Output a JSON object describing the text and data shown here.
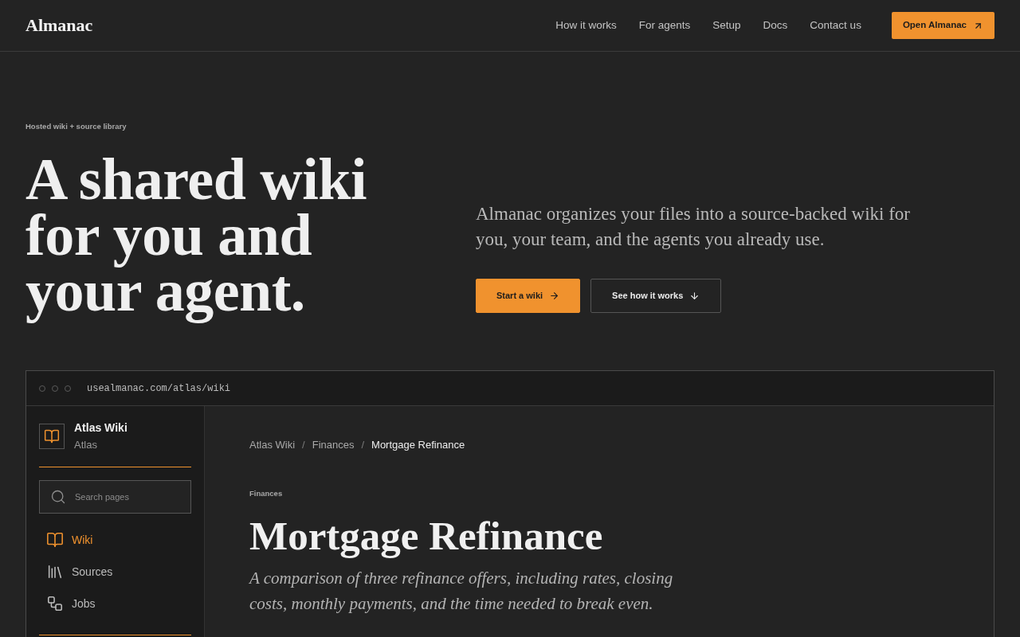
{
  "header": {
    "logo": "Almanac",
    "nav": [
      {
        "label": "How it works"
      },
      {
        "label": "For agents"
      },
      {
        "label": "Setup"
      },
      {
        "label": "Docs"
      },
      {
        "label": "Contact us"
      }
    ],
    "cta": "Open Almanac"
  },
  "hero": {
    "eyebrow": "Hosted wiki + source library",
    "headline": [
      "A shared wiki",
      "for you and",
      "your agent."
    ],
    "lede": "Almanac organizes your files into a source-backed wiki for you, your team, and the agents you already use.",
    "actions": [
      {
        "label": "Start a wiki",
        "kind": "primary"
      },
      {
        "label": "See how it works",
        "kind": "secondary"
      }
    ]
  },
  "preview": {
    "url": "usealmanac.com/atlas/wiki",
    "sidebar": {
      "wiki_name": "Atlas Wiki",
      "workspace": "Atlas",
      "search": {
        "placeholder": "Search pages"
      },
      "items": [
        {
          "label": "Wiki",
          "selected": true
        },
        {
          "label": "Sources",
          "selected": false
        },
        {
          "label": "Jobs",
          "selected": false
        }
      ]
    },
    "page": {
      "breadcrumb": [
        {
          "label": "Atlas Wiki",
          "kind": "link"
        },
        {
          "label": "/",
          "kind": "separator"
        },
        {
          "label": "Finances",
          "kind": "link"
        },
        {
          "label": "/",
          "kind": "separator"
        },
        {
          "label": "Mortgage Refinance",
          "kind": "current"
        }
      ],
      "category": "Finances",
      "title": "Mortgage Refinance",
      "summary": "A comparison of three refinance offers, including rates, closing costs, monthly payments, and the time needed to break even."
    }
  }
}
